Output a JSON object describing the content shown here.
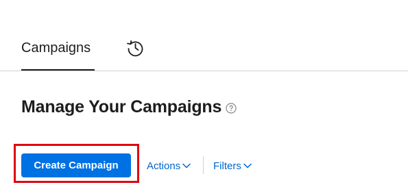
{
  "tabs": {
    "campaigns_label": "Campaigns",
    "history_icon": "history-icon"
  },
  "page": {
    "title": "Manage Your Campaigns",
    "help_icon": "help-icon"
  },
  "toolbar": {
    "create_label": "Create Campaign",
    "actions_label": "Actions",
    "filters_label": "Filters"
  },
  "colors": {
    "primary": "#0071e3",
    "link": "#0066cc",
    "highlight": "#e0000f"
  }
}
